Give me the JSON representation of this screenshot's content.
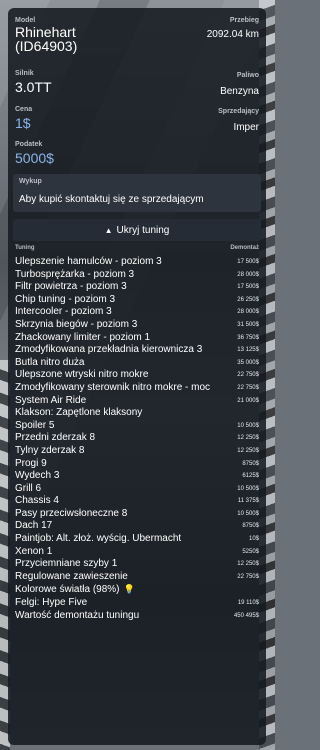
{
  "vehicle": {
    "model_label": "Model",
    "model_value": "Rhinehart (ID64903)",
    "mileage_label": "Przebieg",
    "mileage_value": "2092.04 km",
    "engine_label": "Silnik",
    "engine_value": "3.0TT",
    "fuel_label": "Paliwo",
    "fuel_value": "Benzyna",
    "price_label": "Cena",
    "price_value": "1$",
    "seller_label": "Sprzedający",
    "seller_value": "Imper",
    "tax_label": "Podatek",
    "tax_value": "5000$"
  },
  "wykup": {
    "label": "Wykup",
    "text": "Aby kupić skontaktuj się ze sprzedającym"
  },
  "toggle": {
    "chevron": "^",
    "label": "Ukryj tuning"
  },
  "tuning": {
    "col_name": "Tuning",
    "col_price": "Demontaż",
    "items": [
      {
        "name": "Ulepszenie hamulców - poziom 3",
        "price": "17 500$"
      },
      {
        "name": "Turbosprężarka - poziom 3",
        "price": "28 000$"
      },
      {
        "name": "Filtr powietrza - poziom 3",
        "price": "17 500$"
      },
      {
        "name": "Chip tuning - poziom 3",
        "price": "26 250$"
      },
      {
        "name": "Intercooler - poziom 3",
        "price": "28 000$"
      },
      {
        "name": "Skrzynia biegów - poziom 3",
        "price": "31 500$"
      },
      {
        "name": "Zhackowany limiter - poziom 1",
        "price": "36 750$"
      },
      {
        "name": "Zmodyfikowana przekładnia kierownicza 3",
        "price": "13 125$"
      },
      {
        "name": "Butla nitro duża",
        "price": "35 000$"
      },
      {
        "name": "Ulepszone wtryski nitro mokre",
        "price": "22 750$"
      },
      {
        "name": "Zmodyfikowany sterownik nitro mokre - moc",
        "price": "22 750$"
      },
      {
        "name": "System Air Ride",
        "price": "21 000$"
      },
      {
        "name": "Klakson: Zapętlone klaksony",
        "price": ""
      },
      {
        "name": "Spoiler 5",
        "price": "10 500$"
      },
      {
        "name": "Przedni zderzak 8",
        "price": "12 250$"
      },
      {
        "name": "Tylny zderzak 8",
        "price": "12 250$"
      },
      {
        "name": "Progi 9",
        "price": "8750$"
      },
      {
        "name": "Wydech 3",
        "price": "6125$"
      },
      {
        "name": "Grill 6",
        "price": "10 500$"
      },
      {
        "name": "Chassis 4",
        "price": "11 375$"
      },
      {
        "name": "Pasy przeciwsłoneczne 8",
        "price": "10 500$"
      },
      {
        "name": "Dach 17",
        "price": "8750$"
      },
      {
        "name": "Paintjob: Alt. złoż. wyścig. Ubermacht",
        "price": "10$"
      },
      {
        "name": "Xenon 1",
        "price": "5250$"
      },
      {
        "name": "Przyciemniane szyby 1",
        "price": "12 250$"
      },
      {
        "name": "Regulowane zawieszenie",
        "price": "22 750$"
      },
      {
        "name": "Kolorowe światła (98%)",
        "price": "",
        "icon": "lightbulb-icon"
      },
      {
        "name": "Felgi: Hype Five",
        "price": "19 110$"
      },
      {
        "name": "Wartość demontażu tuningu",
        "price": "450 495$"
      }
    ]
  }
}
